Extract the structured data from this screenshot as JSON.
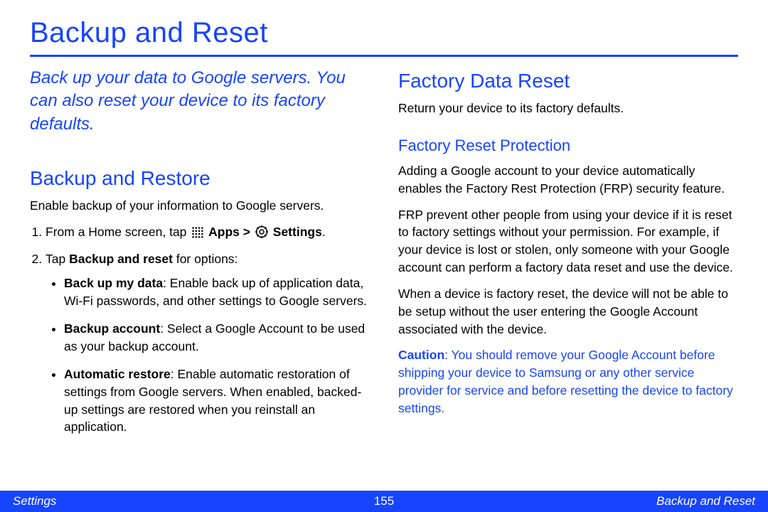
{
  "pageTitle": "Backup and Reset",
  "intro": "Back up your data to Google servers. You can also reset your device to its factory defaults.",
  "left": {
    "heading": "Backup and Restore",
    "lead": "Enable backup of your information to Google servers.",
    "step1_pre": "From a Home screen, tap ",
    "apps_label": "Apps",
    "gt": ">",
    "settings_label": "Settings",
    "step1_post": ".",
    "step2_pre": "Tap ",
    "step2_bold": "Backup and reset",
    "step2_post": " for options:",
    "bullets": {
      "b1_bold": "Back up my data",
      "b1_text": ": Enable back up of application data, Wi-Fi passwords, and other settings to Google servers.",
      "b2_bold": "Backup account",
      "b2_text": ": Select a Google Account to be used as your backup account.",
      "b3_bold": "Automatic restore",
      "b3_text": ": Enable automatic restoration of settings from Google servers. When enabled, backed-up settings are restored when you reinstall an application."
    }
  },
  "right": {
    "heading": "Factory Data Reset",
    "lead": "Return your device to its factory defaults.",
    "subheading": "Factory Reset Protection",
    "p1": "Adding a Google account to your device automatically enables the Factory Rest Protection (FRP) security feature.",
    "p2": "FRP prevent other people from using your device if it is reset to factory settings without your permission. For example, if your device is lost or stolen, only someone with your Google account can perform a factory data reset and use the device.",
    "p3": "When a device is factory reset, the device will not be able to be setup without the user entering the Google Account associated with the device.",
    "caution_label": "Caution",
    "caution_text": ": You should remove your Google Account before shipping your device to Samsung or any other service provider for service and before resetting the device to factory settings."
  },
  "footer": {
    "left": "Settings",
    "center": "155",
    "right": "Backup and Reset"
  }
}
